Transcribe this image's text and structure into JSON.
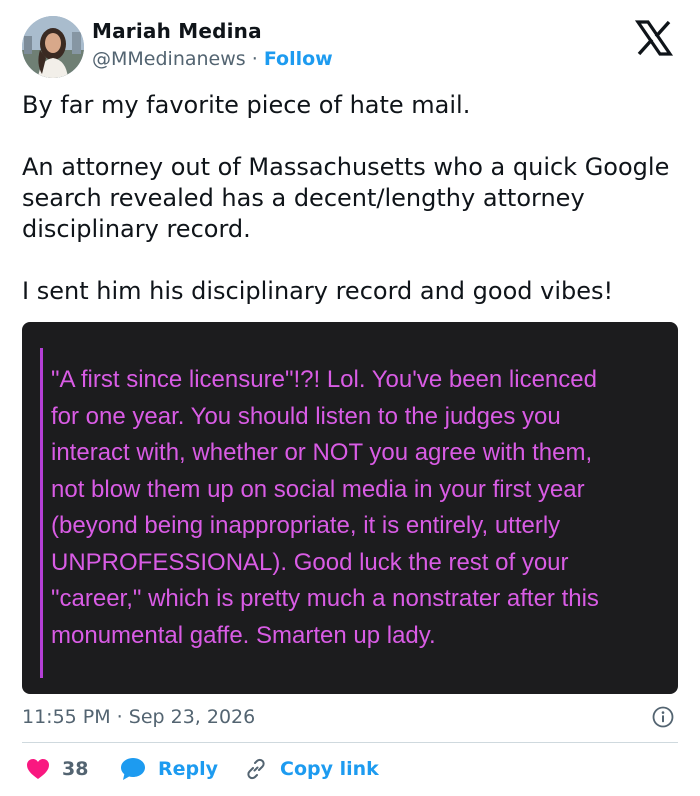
{
  "author": {
    "name": "Mariah Medina",
    "handle": "@MMedinanews",
    "separator": "·",
    "follow_label": "Follow"
  },
  "tweet": {
    "paragraphs": [
      "By far my favorite piece of hate mail.",
      "An attorney out of Massachusetts who a quick Google search revealed has a decent/lengthy attorney disciplinary record.",
      "I sent him his disciplinary record and good vibes!"
    ]
  },
  "image": {
    "lines": [
      "\"A first since licensure\"!?! Lol. You've been licenced",
      "for one year. You should listen to the judges you",
      "interact with, whether or NOT you agree with them,",
      "not blow them up on social media in your first year",
      "(beyond being inappropriate, it is entirely, utterly",
      "UNPROFESSIONAL). Good luck the rest of your",
      "\"career,\" which is pretty much a nonstrater after this",
      "monumental gaffe. Smarten up lady."
    ]
  },
  "footer": {
    "timestamp": "11:55 PM · Sep 23, 2026",
    "likes_count": "38",
    "reply_label": "Reply",
    "copy_link_label": "Copy link"
  },
  "colors": {
    "accent": "#1d9bf0",
    "like": "#f91880",
    "quote_text": "#d95ce5",
    "quote_bg": "#1c1c1e"
  },
  "icons": [
    "x-logo-icon",
    "info-icon",
    "heart-icon",
    "reply-bubble-icon",
    "link-icon"
  ]
}
